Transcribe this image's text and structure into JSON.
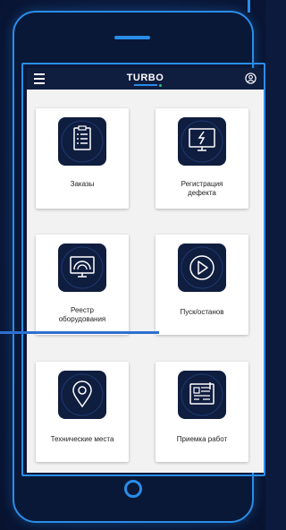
{
  "header": {
    "brand": "TURBO"
  },
  "icons": {
    "menu": "menu-icon",
    "user": "user-icon"
  },
  "colors": {
    "accent": "#2a8de8",
    "navy": "#0f1d3f",
    "background": "#0b1a3d",
    "screen": "#f2f2f2"
  },
  "tiles": [
    {
      "label": "Заказы",
      "icon": "orders-icon"
    },
    {
      "label": "Регистрация дефекта",
      "icon": "defect-icon"
    },
    {
      "label": "Реестр оборудования",
      "icon": "equipment-icon"
    },
    {
      "label": "Пуск/останов",
      "icon": "play-icon"
    },
    {
      "label": "Технические места",
      "icon": "location-pin-icon"
    },
    {
      "label": "Приемка работ",
      "icon": "blueprint-icon"
    }
  ]
}
